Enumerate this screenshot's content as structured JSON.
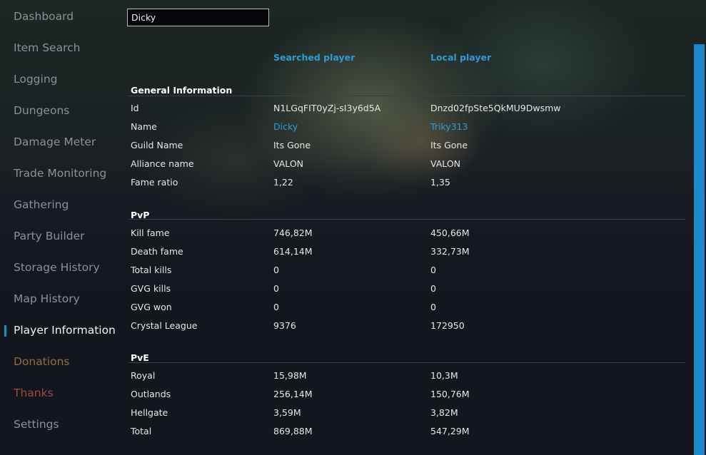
{
  "sidebar": {
    "items": [
      {
        "label": "Dashboard"
      },
      {
        "label": "Item Search"
      },
      {
        "label": "Logging"
      },
      {
        "label": "Dungeons"
      },
      {
        "label": "Damage Meter"
      },
      {
        "label": "Trade Monitoring"
      },
      {
        "label": "Gathering"
      },
      {
        "label": "Party Builder"
      },
      {
        "label": "Storage History"
      },
      {
        "label": "Map History"
      },
      {
        "label": "Player Information"
      },
      {
        "label": "Donations"
      },
      {
        "label": "Thanks"
      },
      {
        "label": "Settings"
      }
    ],
    "active": "Player Information"
  },
  "search": {
    "value": "Dicky"
  },
  "columns": {
    "searched": "Searched player",
    "local": "Local player"
  },
  "general": {
    "title": "General Information",
    "rows": [
      {
        "label": "Id",
        "searched": "N1LGqFIT0yZj-sI3y6d5A",
        "local": "Dnzd02fpSte5QkMU9Dwsmw"
      },
      {
        "label": "Name",
        "searched": "Dicky",
        "local": "Triky313"
      },
      {
        "label": "Guild Name",
        "searched": "Its Gone",
        "local": "Its Gone"
      },
      {
        "label": "Alliance name",
        "searched": "VALON",
        "local": "VALON"
      },
      {
        "label": "Fame ratio",
        "searched": "1,22",
        "local": "1,35"
      }
    ]
  },
  "pvp": {
    "title": "PvP",
    "rows": [
      {
        "label": "Kill fame",
        "searched": "746,82M",
        "local": "450,66M"
      },
      {
        "label": "Death fame",
        "searched": "614,14M",
        "local": "332,73M"
      },
      {
        "label": "Total kills",
        "searched": "0",
        "local": "0"
      },
      {
        "label": "GVG kills",
        "searched": "0",
        "local": "0"
      },
      {
        "label": "GVG won",
        "searched": "0",
        "local": "0"
      },
      {
        "label": "Crystal League",
        "searched": "9376",
        "local": "172950"
      }
    ]
  },
  "pve": {
    "title": "PvE",
    "rows": [
      {
        "label": "Royal",
        "searched": "15,98M",
        "local": "10,3M"
      },
      {
        "label": "Outlands",
        "searched": "256,14M",
        "local": "150,76M"
      },
      {
        "label": "Hellgate",
        "searched": "3,59M",
        "local": "3,82M"
      },
      {
        "label": "Total",
        "searched": "869,88M",
        "local": "547,29M"
      }
    ]
  },
  "colors": {
    "accent": "#2d9bd7",
    "donations": "#8d6e3a",
    "thanks": "#9b4747"
  }
}
